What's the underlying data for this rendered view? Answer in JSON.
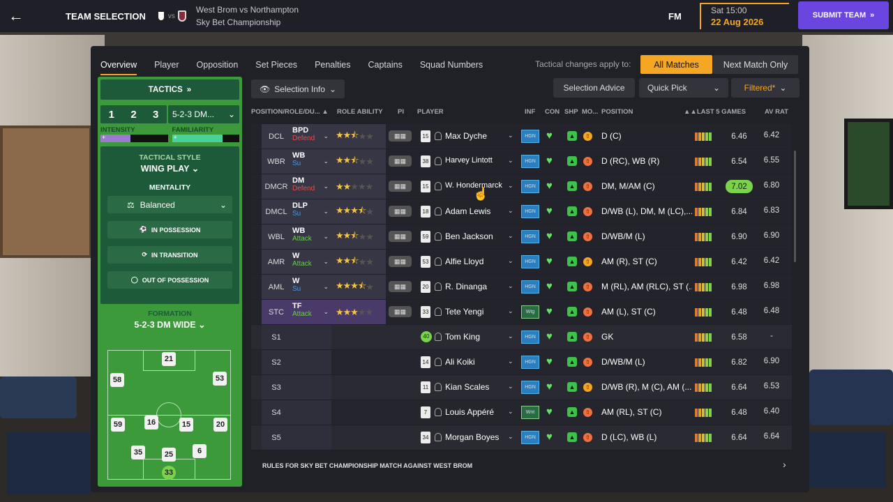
{
  "header": {
    "back_icon": "back-arrow-icon",
    "title": "TEAM SELECTION",
    "vs": "vs",
    "match_title": "West Brom vs Northampton",
    "competition": "Sky Bet Championship",
    "fm": "FM",
    "time": "Sat 15:00",
    "date": "22 Aug 2026",
    "submit": "SUBMIT TEAM"
  },
  "tabs": [
    "Overview",
    "Player",
    "Opposition",
    "Set Pieces",
    "Penalties",
    "Captains",
    "Squad Numbers"
  ],
  "tactical_changes": {
    "label": "Tactical changes apply to:",
    "all": "All Matches",
    "next": "Next Match Only"
  },
  "left": {
    "tactics_btn": "TACTICS",
    "slots": [
      "1",
      "2",
      "3"
    ],
    "formation_short": "5-2-3 DM...",
    "intensity_label": "INTENSITY",
    "familiarity_label": "FAMILIARITY",
    "intensity": 0.45,
    "familiarity": 0.75,
    "style_label": "TACTICAL STYLE",
    "style_value": "WING PLAY",
    "mentality_label": "MENTALITY",
    "mentality_value": "Balanced",
    "in_possession": "IN POSSESSION",
    "in_transition": "IN TRANSITION",
    "out_possession": "OUT OF POSSESSION",
    "formation_label": "FORMATION",
    "formation_value": "5-2-3 DM WIDE",
    "pitch_numbers": [
      "21",
      "58",
      "53",
      "59",
      "16",
      "15",
      "20",
      "35",
      "25",
      "6",
      "33"
    ]
  },
  "toolbar": {
    "selection_info": "Selection Info",
    "selection_advice": "Selection Advice",
    "quick_pick": "Quick Pick",
    "filtered": "Filtered*"
  },
  "columns": {
    "pos_role": "POSITION/ROLE/DU...",
    "role_ability": "ROLE ABILITY",
    "pi": "PI",
    "player": "PLAYER",
    "inf": "INF",
    "con": "CON",
    "shp": "SHP",
    "mo": "MO...",
    "position": "POSITION",
    "last5": "LAST 5 GAMES",
    "avrat": "AV RAT"
  },
  "rows": [
    {
      "pos": "DCL",
      "role": "BPD",
      "duty": "Defend",
      "stars": 2.5,
      "num": "15",
      "name": "Max Dyche",
      "inf": "HGN",
      "position": "D (C)",
      "last": "6.46",
      "av": "6.42"
    },
    {
      "pos": "WBR",
      "role": "WB",
      "duty": "Su",
      "stars": 2.5,
      "num": "38",
      "name": "Harvey Lintott",
      "inf": "HGN",
      "position": "D (RC), WB (R)",
      "last": "6.54",
      "av": "6.55"
    },
    {
      "pos": "DMCR",
      "role": "DM",
      "duty": "Defend",
      "stars": 2,
      "num": "15",
      "name": "W. Hondermarck",
      "inf": "HGN",
      "position": "DM, M/AM (C)",
      "last": "7.02",
      "av": "6.80"
    },
    {
      "pos": "DMCL",
      "role": "DLP",
      "duty": "Su",
      "stars": 3.5,
      "num": "18",
      "name": "Adam Lewis",
      "inf": "HGN",
      "position": "D/WB (L), DM, M (LC),...",
      "last": "6.84",
      "av": "6.83"
    },
    {
      "pos": "WBL",
      "role": "WB",
      "duty": "Attack",
      "stars": 2.5,
      "num": "59",
      "name": "Ben Jackson",
      "inf": "HGN",
      "position": "D/WB/M (L)",
      "last": "6.90",
      "av": "6.90"
    },
    {
      "pos": "AMR",
      "role": "W",
      "duty": "Attack",
      "stars": 2.5,
      "num": "53",
      "name": "Alfie Lloyd",
      "inf": "HGN",
      "position": "AM (R), ST (C)",
      "last": "6.42",
      "av": "6.42"
    },
    {
      "pos": "AML",
      "role": "W",
      "duty": "Su",
      "stars": 3.5,
      "num": "20",
      "name": "R. Dinanga",
      "inf": "HGN",
      "position": "M (RL), AM (RLC), ST (...",
      "last": "6.98",
      "av": "6.98"
    },
    {
      "pos": "STC",
      "role": "TF",
      "duty": "Attack",
      "stars": 3,
      "num": "33",
      "name": "Tete Yengi",
      "inf": "Wtg",
      "position": "AM (L), ST (C)",
      "last": "6.48",
      "av": "6.48"
    },
    {
      "pos": "S1",
      "num": "40",
      "name": "Tom King",
      "inf": "HGN",
      "position": "GK",
      "last": "6.58",
      "av": "-"
    },
    {
      "pos": "S2",
      "num": "14",
      "name": "Ali Koiki",
      "inf": "HGN",
      "position": "D/WB/M (L)",
      "last": "6.82",
      "av": "6.90"
    },
    {
      "pos": "S3",
      "num": "11",
      "name": "Kian Scales",
      "inf": "HGN",
      "position": "D/WB (R), M (C), AM (...",
      "last": "6.64",
      "av": "6.53"
    },
    {
      "pos": "S4",
      "num": "7",
      "name": "Louis Appéré",
      "inf": "Wnt",
      "position": "AM (RL), ST (C)",
      "last": "6.48",
      "av": "6.40"
    },
    {
      "pos": "S5",
      "num": "34",
      "name": "Morgan Boyes",
      "inf": "HGN",
      "position": "D (LC), WB (L)",
      "last": "6.64",
      "av": "6.64"
    }
  ],
  "rules": "RULES FOR SKY BET CHAMPIONSHIP MATCH AGAINST WEST BROM",
  "colors": {
    "accent": "#f5a623",
    "submit": "#6a45e0",
    "pitch": "#3c9a3a"
  }
}
